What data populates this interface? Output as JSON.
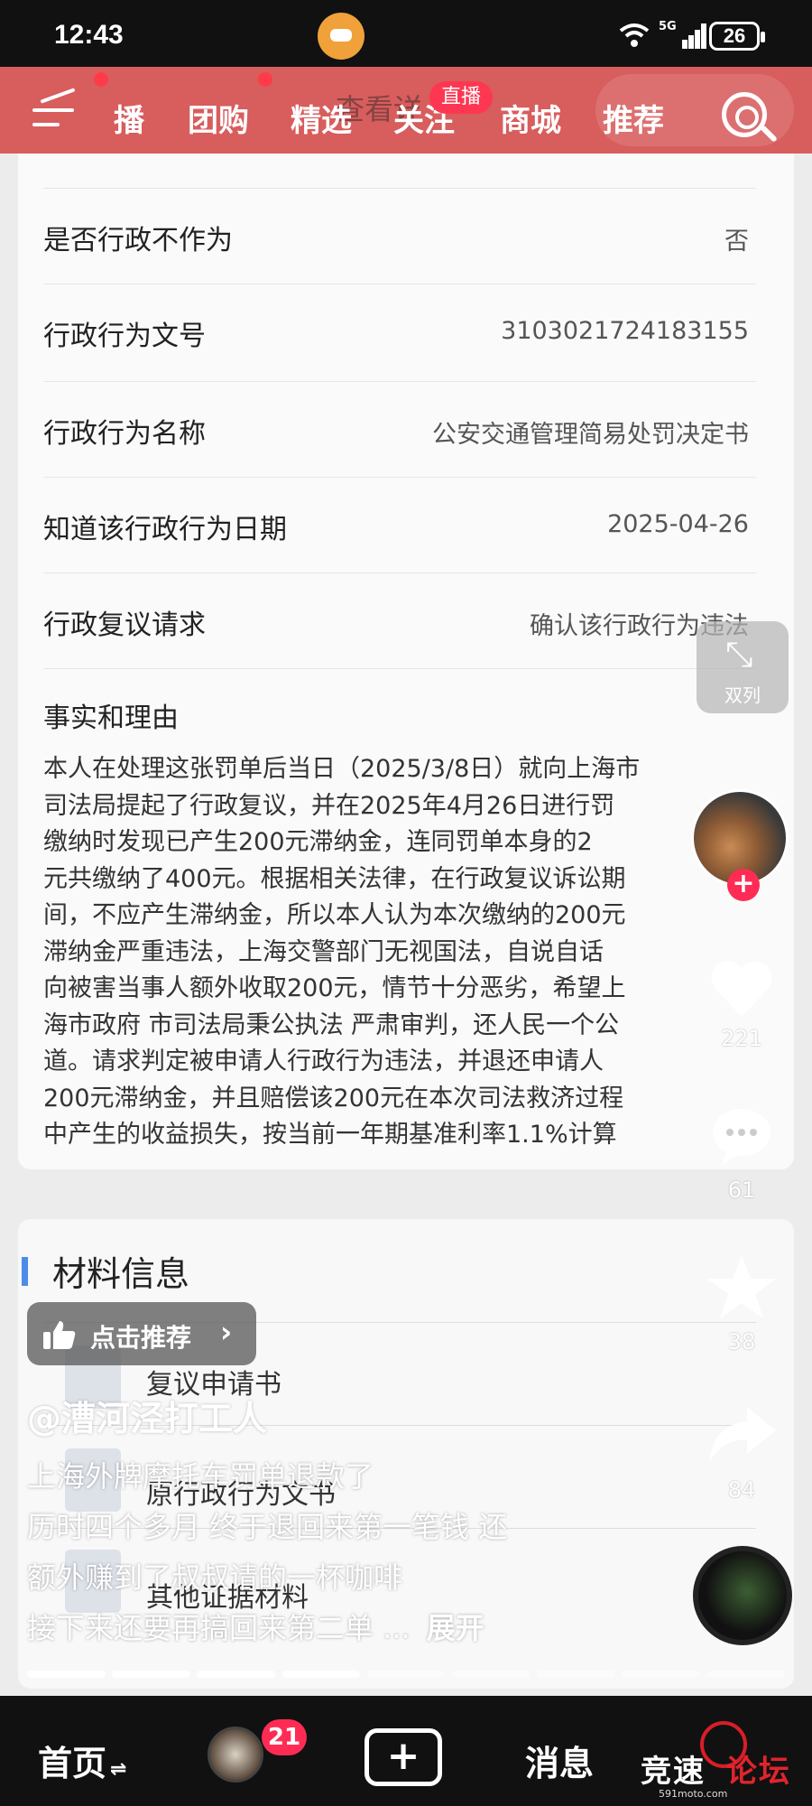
{
  "status_bar": {
    "time": "12:43",
    "network": "5G",
    "battery": "26"
  },
  "nav": {
    "tabs": [
      "播",
      "团购",
      "精选",
      "关注",
      "商城",
      "推荐"
    ],
    "behind_text": "查看详",
    "live_badge": "直播"
  },
  "detail": {
    "rows": [
      {
        "label": "是否行政不作为",
        "value": "否"
      },
      {
        "label": "行政行为文号",
        "value": "3103021724183155"
      },
      {
        "label": "行政行为名称",
        "value": "公安交通管理简易处罚决定书"
      },
      {
        "label": "知道该行政行为日期",
        "value": "2025-04-26"
      },
      {
        "label": "行政复议请求",
        "value": "确认该行政行为违法"
      }
    ],
    "facts_title": "事实和理由",
    "facts_lines": [
      "本人在处理这张罚单后当日（2025/3/8日）就向上海市",
      "司法局提起了行政复议，并在2025年4月26日进行罚",
      "缴纳时发现已产生200元滞纳金，连同罚单本身的2",
      "元共缴纳了400元。根据相关法律，在行政复议诉讼期",
      "间，不应产生滞纳金，所以本人认为本次缴纳的200元",
      "滞纳金严重违法，上海交警部门无视国法，自说自话",
      "向被害当事人额外收取200元，情节十分恶劣，希望上",
      "海市政府 市司法局秉公执法 严肃审判，还人民一个公",
      "道。请求判定被申请人行政行为违法，并退还申请人",
      "200元滞纳金，并且赔偿该200元在本次司法救济过程",
      "中产生的收益损失，按当前一年期基准利率1.1%计算"
    ]
  },
  "materials": {
    "title": "材料信息",
    "items": [
      "复议申请书",
      "原行政行为文书",
      "其他证据材料"
    ]
  },
  "overlay": {
    "recommend_label": "点击推荐",
    "author": "@漕河泾打工人",
    "caption_lines": [
      "上海外牌摩托车罚单退款了",
      "历时四个多月  终于退回来第一笔钱 还",
      "额外赚到了叔叔请的一杯咖啡",
      "接下来还要再搞回来第二单 ..."
    ],
    "expand_label": "展开",
    "dual_label": "双列",
    "follow_symbol": "+",
    "like_count": "221",
    "comment_count": "61",
    "favorite_count": "38",
    "share_count": "84",
    "progress": {
      "segments": 9,
      "watched": 4
    }
  },
  "bottom_nav": {
    "home_label": "首页",
    "home_suffix": "⇌",
    "friend_badge": "21",
    "plus_symbol": "+",
    "message_label": "消息"
  },
  "watermark": {
    "brand_a": "竞速",
    "brand_b": "论坛",
    "url": "591moto.com"
  },
  "colors": {
    "nav_red": "#d85d5d",
    "badge_red": "#fe2c55",
    "accent_blue": "#4d8ce8"
  }
}
